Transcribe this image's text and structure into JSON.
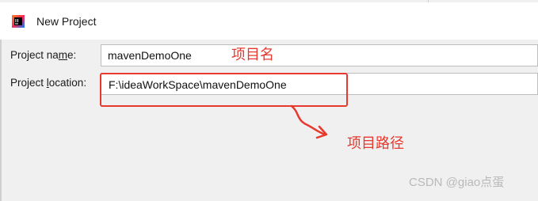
{
  "window": {
    "title": "New Project",
    "icon": "intellij-idea-icon"
  },
  "form": {
    "name_label_prefix": "Project na",
    "name_label_mnemonic": "m",
    "name_label_suffix": "e:",
    "name_value": "mavenDemoOne",
    "location_label_prefix": "Project ",
    "location_label_mnemonic": "l",
    "location_label_suffix": "ocation:",
    "location_value": "F:\\ideaWorkSpace\\mavenDemoOne"
  },
  "annotations": {
    "name_note": "项目名",
    "location_note": "项目路径",
    "colors": {
      "annotation_red": "#e8392e"
    }
  },
  "watermark": {
    "text": "CSDN @giao点蛋"
  }
}
